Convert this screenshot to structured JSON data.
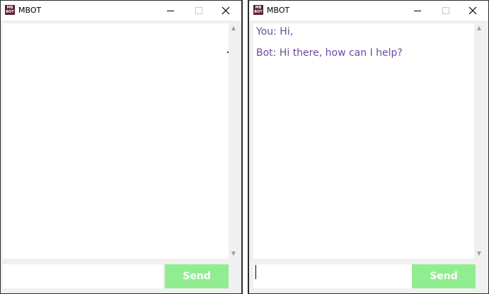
{
  "windows": [
    {
      "title": "MBOT",
      "icon_text": "MB BOT",
      "messages": [],
      "input_value": "",
      "send_label": "Send"
    },
    {
      "title": "MBOT",
      "icon_text": "MB BOT",
      "messages": [
        "You: Hi,",
        "Bot: Hi there, how can I help?"
      ],
      "input_value": "",
      "send_label": "Send"
    }
  ],
  "colors": {
    "send_button_bg": "#90ee90",
    "message_text": "#6a4aa0",
    "app_icon_bg": "#5b1f2e"
  }
}
